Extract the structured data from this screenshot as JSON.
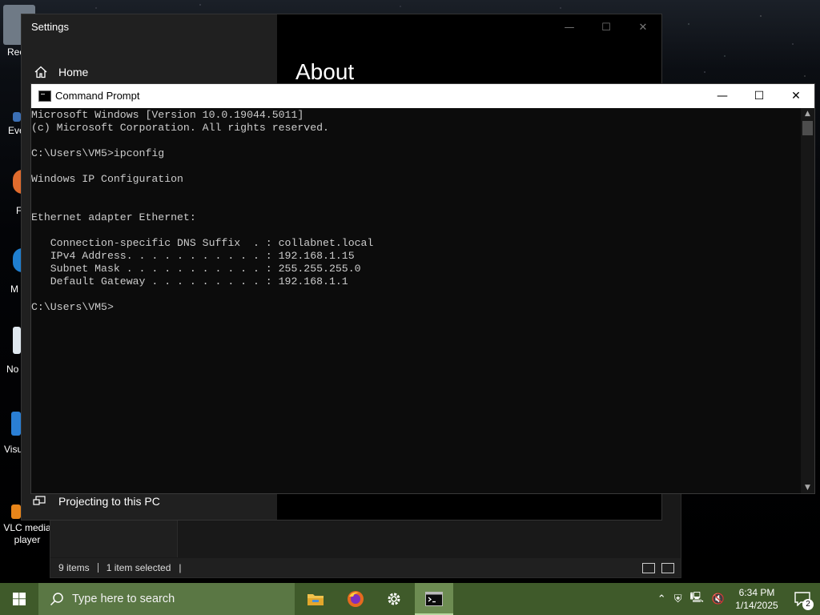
{
  "desktop": {
    "icons": [
      {
        "label": "Rec",
        "color": "#6f7a86"
      },
      {
        "label": "Eve",
        "color": "#3b6fb5"
      },
      {
        "label": "F",
        "color": "#e06b2d"
      },
      {
        "label": "M",
        "color": "#1f7fd0"
      },
      {
        "label": "No",
        "color": "#dfe8ef"
      },
      {
        "label": "Visu",
        "color": "#2a7fd4"
      },
      {
        "label": "VLC media player",
        "color": "#e8851a"
      }
    ]
  },
  "explorer": {
    "status": {
      "items_count": "9 items",
      "selection": "1 item selected",
      "cursor": "|"
    }
  },
  "settings": {
    "title": "Settings",
    "home_label": "Home",
    "page_title": "About",
    "projecting_label": "Projecting to this PC",
    "controls": {
      "minimize": "—",
      "maximize": "☐",
      "close": "✕"
    }
  },
  "cmd": {
    "title": "Command Prompt",
    "controls": {
      "minimize": "—",
      "maximize": "☐",
      "close": "✕"
    },
    "lines": [
      "Microsoft Windows [Version 10.0.19044.5011]",
      "(c) Microsoft Corporation. All rights reserved.",
      "",
      "C:\\Users\\VM5>ipconfig",
      "",
      "Windows IP Configuration",
      "",
      "",
      "Ethernet adapter Ethernet:",
      "",
      "   Connection-specific DNS Suffix  . : collabnet.local",
      "   IPv4 Address. . . . . . . . . . . : 192.168.1.15",
      "   Subnet Mask . . . . . . . . . . . : 255.255.255.0",
      "   Default Gateway . . . . . . . . . : 192.168.1.1",
      "",
      "C:\\Users\\VM5>"
    ]
  },
  "taskbar": {
    "search_placeholder": "Type here to search",
    "apps": [
      {
        "name": "file-explorer-icon",
        "active": false
      },
      {
        "name": "firefox-icon",
        "active": false
      },
      {
        "name": "settings-gear-icon",
        "active": false
      },
      {
        "name": "command-prompt-icon",
        "active": true
      }
    ],
    "tray": {
      "time": "6:34 PM",
      "date": "1/14/2025",
      "notification_count": "2"
    }
  }
}
